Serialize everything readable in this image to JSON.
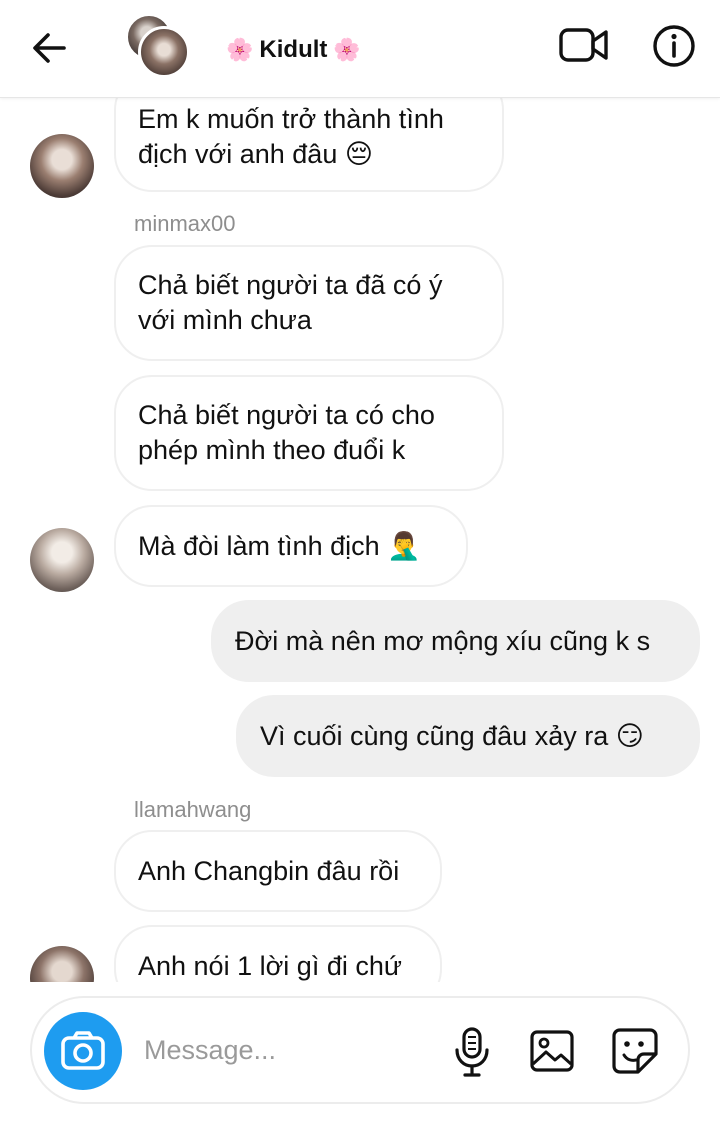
{
  "header": {
    "title": "Kidult",
    "title_left_decoration": "🌸",
    "title_right_decoration": "🌸",
    "back_icon": "arrow-left-icon",
    "video_icon": "video-camera-icon",
    "info_icon": "info-circle-icon"
  },
  "messages": [
    {
      "direction": "incoming",
      "lines": [
        "Em k muốn trở thành tình",
        "địch với anh đâu"
      ],
      "emoji": "😔"
    },
    {
      "direction": "incoming",
      "sender": "minmax00",
      "lines": [
        "Chả biết người ta đã có ý",
        "với mình chưa"
      ]
    },
    {
      "direction": "incoming",
      "lines": [
        "Chả biết người ta có cho",
        "phép mình theo đuổi k"
      ]
    },
    {
      "direction": "incoming",
      "lines": [
        "Mà đòi làm tình địch"
      ],
      "emoji": "🤦‍♂️"
    },
    {
      "direction": "outgoing",
      "lines": [
        "Đời mà nên mơ mộng xíu cũng k s"
      ]
    },
    {
      "direction": "outgoing",
      "lines": [
        "Vì cuối cùng cũng đâu xảy ra"
      ],
      "emoji": "😏"
    },
    {
      "direction": "incoming",
      "sender": "llamahwang",
      "lines": [
        "Anh Changbin đâu rồi"
      ]
    },
    {
      "direction": "incoming",
      "lines": [
        "Anh nói 1 lời gì đi chứ"
      ]
    }
  ],
  "composer": {
    "placeholder": "Message...",
    "value": "",
    "camera_icon": "camera-icon",
    "mic_icon": "microphone-icon",
    "gallery_icon": "image-gallery-icon",
    "sticker_icon": "sticker-icon"
  },
  "colors": {
    "camera_button": "#1e9cf0",
    "outgoing_bubble": "#efefef",
    "bubble_border": "#efefef",
    "sender_name": "#8e8e8e"
  }
}
